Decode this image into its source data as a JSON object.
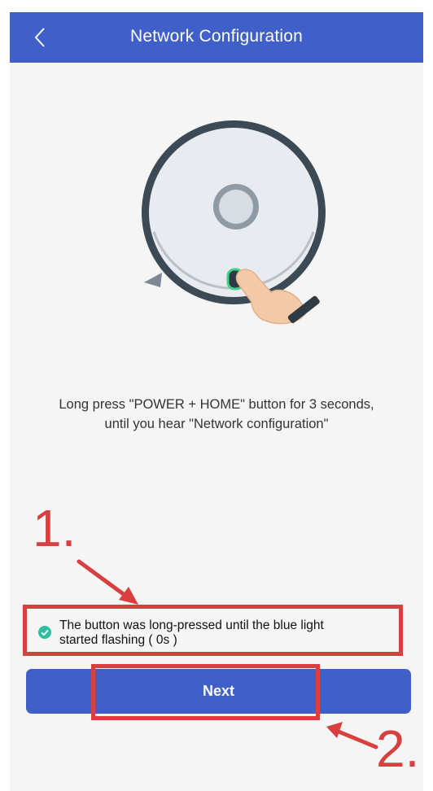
{
  "header": {
    "title": "Network Configuration",
    "back_icon": "chevron-left-icon",
    "background_color": "#3f5fc9"
  },
  "illustration": {
    "icon": "robot-vacuum-press-icon"
  },
  "instruction": {
    "line1": "Long press \"POWER + HOME\" button for 3 seconds,",
    "line2": "until you hear \"Network configuration\""
  },
  "confirmation": {
    "checked": true,
    "line1": "The button was long-pressed until the blue light",
    "line2": "started flashing ( 0s )",
    "check_color": "#2fbfa0"
  },
  "next_button": {
    "label": "Next",
    "color": "#3f5fc9"
  },
  "annotations": {
    "label1": "1.",
    "label2": "2.",
    "color": "#d83f3f"
  }
}
